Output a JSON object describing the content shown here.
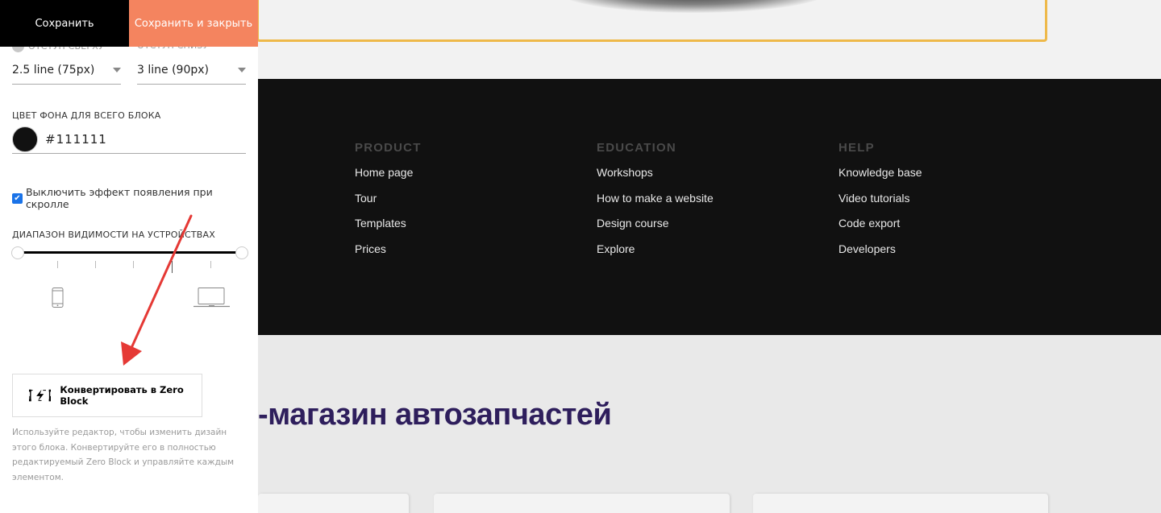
{
  "header": {
    "save_label": "Сохранить",
    "save_close_label": "Сохранить и закрыть"
  },
  "padding": {
    "top_label": "Отступ сверху",
    "top_value": "2.5 line (75px)",
    "bottom_label": "Отступ снизу",
    "bottom_value": "3 line (90px)"
  },
  "background": {
    "label": "Цвет фона для всего блока",
    "value": "#111111"
  },
  "scroll_effect": {
    "label": "Выключить эффект появления при скролле",
    "checked": true
  },
  "visibility": {
    "label": "Диапазон видимости на устройствах",
    "range_start": 0,
    "range_end": 1,
    "min_device_icon": "phone-icon",
    "max_device_icon": "laptop-icon"
  },
  "zero_block": {
    "button_label": "Конвертировать в Zero Block",
    "icon": "zero-block-lightning-icon",
    "description": "Используйте редактор, чтобы изменить дизайн этого блока. Конвертируйте его в полностью редактируемый Zero Block и управляйте каждым элементом."
  },
  "colors": {
    "save_close_bg": "#f4845f",
    "selection_frame": "#eeb94a",
    "footer_bg": "#111111",
    "title_color": "#2e1e5c",
    "annotation_arrow": "#e53935"
  },
  "footer": {
    "columns": [
      {
        "heading": "PRODUCT",
        "links": [
          "Home page",
          "Tour",
          "Templates",
          "Prices"
        ]
      },
      {
        "heading": "EDUCATION",
        "links": [
          "Workshops",
          "How to make a website",
          "Design course",
          "Explore"
        ]
      },
      {
        "heading": "HELP",
        "links": [
          "Knowledge base",
          "Video tutorials",
          "Code export",
          "Developers"
        ]
      }
    ]
  },
  "shop": {
    "title": "-магазин автозапчастей"
  }
}
